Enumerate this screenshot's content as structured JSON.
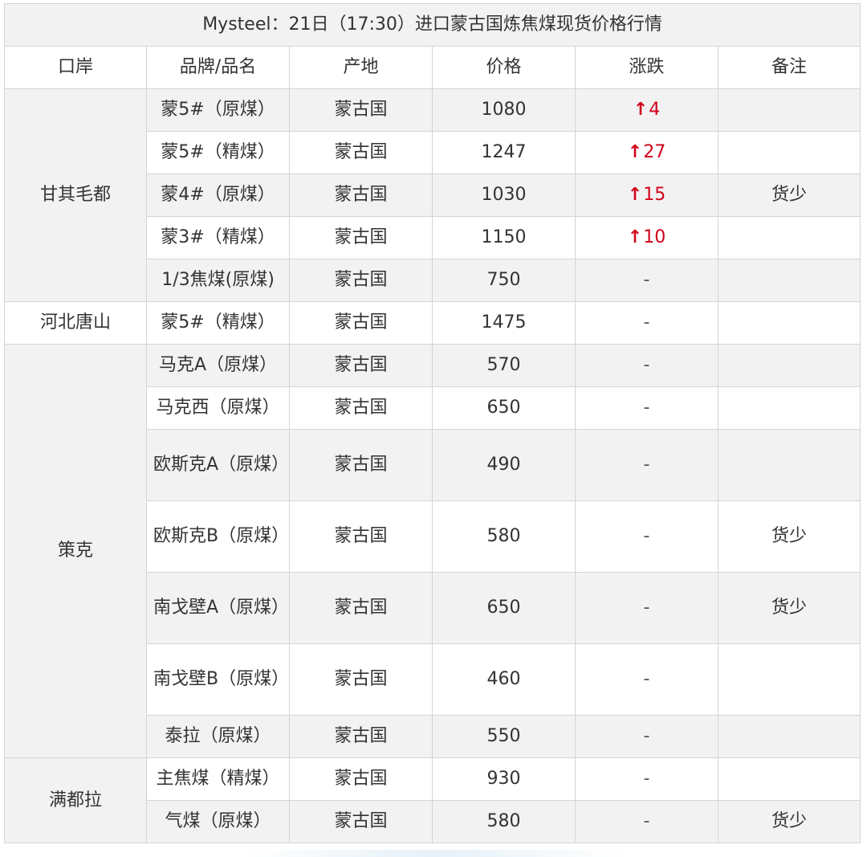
{
  "title": "Mysteel：21日（17:30）进口蒙古国炼焦煤现货价格行情",
  "headers": [
    "口岸",
    "品牌/品名",
    "产地",
    "价格",
    "涨跌",
    "备注"
  ],
  "ports": [
    "甘其毛都",
    "河北唐山",
    "策克",
    "满都拉"
  ],
  "rows": [
    {
      "brand": "蒙5#（原煤）",
      "origin": "蒙古国",
      "price": "1080",
      "change": "4",
      "note": ""
    },
    {
      "brand": "蒙5#（精煤）",
      "origin": "蒙古国",
      "price": "1247",
      "change": "27",
      "note": ""
    },
    {
      "brand": "蒙4#（原煤）",
      "origin": "蒙古国",
      "price": "1030",
      "change": "15",
      "note": "货少"
    },
    {
      "brand": "蒙3#（精煤）",
      "origin": "蒙古国",
      "price": "1150",
      "change": "10",
      "note": ""
    },
    {
      "brand": "1/3焦煤(原煤)",
      "origin": "蒙古国",
      "price": "750",
      "change": "-",
      "note": ""
    },
    {
      "brand": "蒙5#（精煤）",
      "origin": "蒙古国",
      "price": "1475",
      "change": "-",
      "note": ""
    },
    {
      "brand": "马克A（原煤）",
      "origin": "蒙古国",
      "price": "570",
      "change": "-",
      "note": ""
    },
    {
      "brand": "马克西（原煤）",
      "origin": "蒙古国",
      "price": "650",
      "change": "-",
      "note": ""
    },
    {
      "brand": "欧斯克A（原煤）",
      "origin": "蒙古国",
      "price": "490",
      "change": "-",
      "note": ""
    },
    {
      "brand": "欧斯克B（原煤）",
      "origin": "蒙古国",
      "price": "580",
      "change": "-",
      "note": "货少"
    },
    {
      "brand": "南戈壁A（原煤）",
      "origin": "蒙古国",
      "price": "650",
      "change": "-",
      "note": "货少"
    },
    {
      "brand": "南戈壁B（原煤）",
      "origin": "蒙古国",
      "price": "460",
      "change": "-",
      "note": ""
    },
    {
      "brand": "泰拉（原煤）",
      "origin": "蒙古国",
      "price": "550",
      "change": "-",
      "note": ""
    },
    {
      "brand": "主焦煤（精煤）",
      "origin": "蒙古国",
      "price": "930",
      "change": "-",
      "note": ""
    },
    {
      "brand": "气煤（原煤）",
      "origin": "蒙古国",
      "price": "580",
      "change": "-",
      "note": "货少"
    }
  ],
  "colors": {
    "up": "#d0021b",
    "stripe": "#f2f2f2",
    "border": "#d4d4d4"
  },
  "icons": {
    "up": "up-arrow-icon"
  }
}
